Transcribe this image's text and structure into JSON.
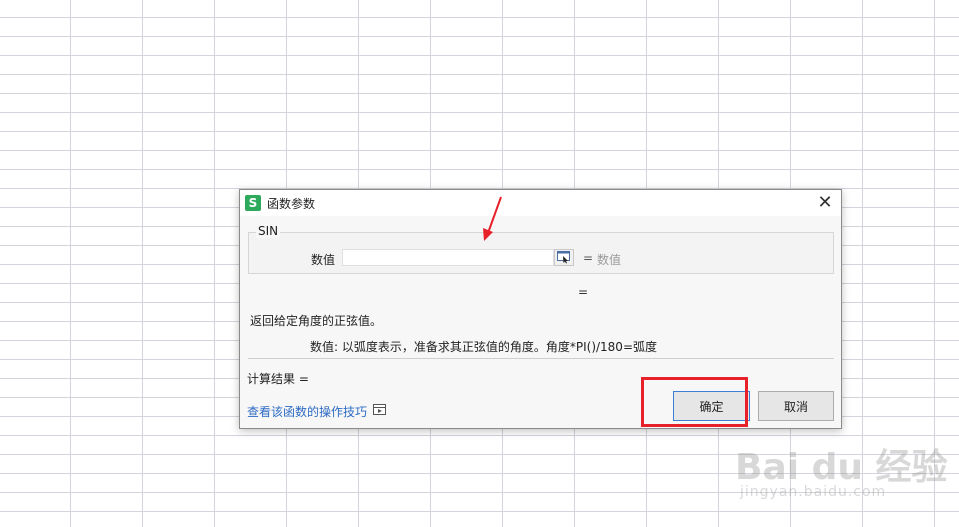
{
  "dialog": {
    "title": "函数参数",
    "app_icon": "S",
    "close_label": "✕",
    "function_name": "SIN",
    "argument": {
      "label": "数值",
      "value": "",
      "equals": "=",
      "hint": "数值"
    },
    "result_equals": "=",
    "description": "返回给定角度的正弦值。",
    "param_description": "数值:  以弧度表示，准备求其正弦值的角度。角度*PI()/180=弧度",
    "calc_result_label": "计算结果  =",
    "help_link": "查看该函数的操作技巧",
    "ok_label": "确定",
    "cancel_label": "取消"
  },
  "watermark": {
    "logo": "Bai du 经验",
    "url": "jingyan.baidu.com"
  },
  "colors": {
    "annotation_red": "#e8202a",
    "link_blue": "#2d6bc4",
    "brand_green": "#2eaa5c",
    "grid_line": "#d4d4dc"
  },
  "icons": {
    "app": "wps-spreadsheet-icon",
    "close": "close-icon",
    "range_select": "range-select-icon",
    "video": "video-icon"
  }
}
